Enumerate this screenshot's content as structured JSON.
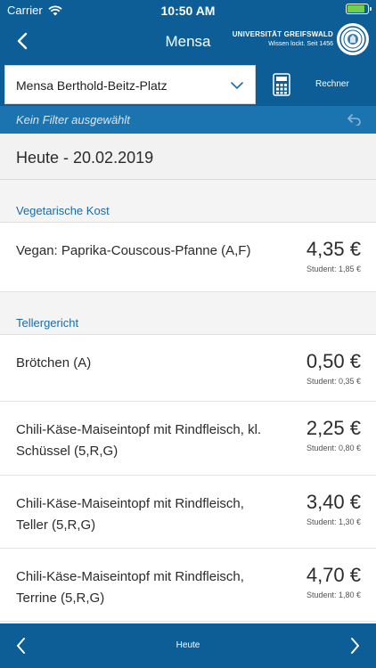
{
  "status": {
    "carrier": "Carrier",
    "time": "10:50 AM",
    "battery_level": 0.9
  },
  "nav": {
    "title": "Mensa",
    "logo_name": "UNIVERSITÄT GREIFSWALD",
    "logo_sub": "Wissen lockt. Seit 1456"
  },
  "selector": {
    "value": "Mensa Berthold-Beitz-Platz",
    "calc_label": "Rechner"
  },
  "filter": {
    "text": "Kein Filter ausgewählt"
  },
  "menu": {
    "date": "Heute - 20.02.2019",
    "categories": [
      {
        "name": "Vegetarische Kost"
      },
      {
        "name": "Tellergericht"
      }
    ],
    "items": [
      {
        "name": "Vegan: Paprika-Couscous-Pfanne (A,F)",
        "price": "4,35 €",
        "student": "Student: 1,85 €"
      },
      {
        "name": "Brötchen (A)",
        "price": "0,50 €",
        "student": "Student: 0,35 €"
      },
      {
        "name": "Chili-Käse-Maiseintopf mit Rindfleisch, kl. Schüssel (5,R,G)",
        "price": "2,25 €",
        "student": "Student: 0,80 €"
      },
      {
        "name": "Chili-Käse-Maiseintopf mit Rindfleisch, Teller (5,R,G)",
        "price": "3,40 €",
        "student": "Student: 1,30 €"
      },
      {
        "name": "Chili-Käse-Maiseintopf mit Rindfleisch, Terrine (5,R,G)",
        "price": "4,70 €",
        "student": "Student: 1,80 €"
      }
    ]
  },
  "bottom": {
    "label": "Heute"
  },
  "colors": {
    "primary": "#0d5d96",
    "filterbar": "#1b73b0",
    "category_text": "#1a6aa6"
  }
}
